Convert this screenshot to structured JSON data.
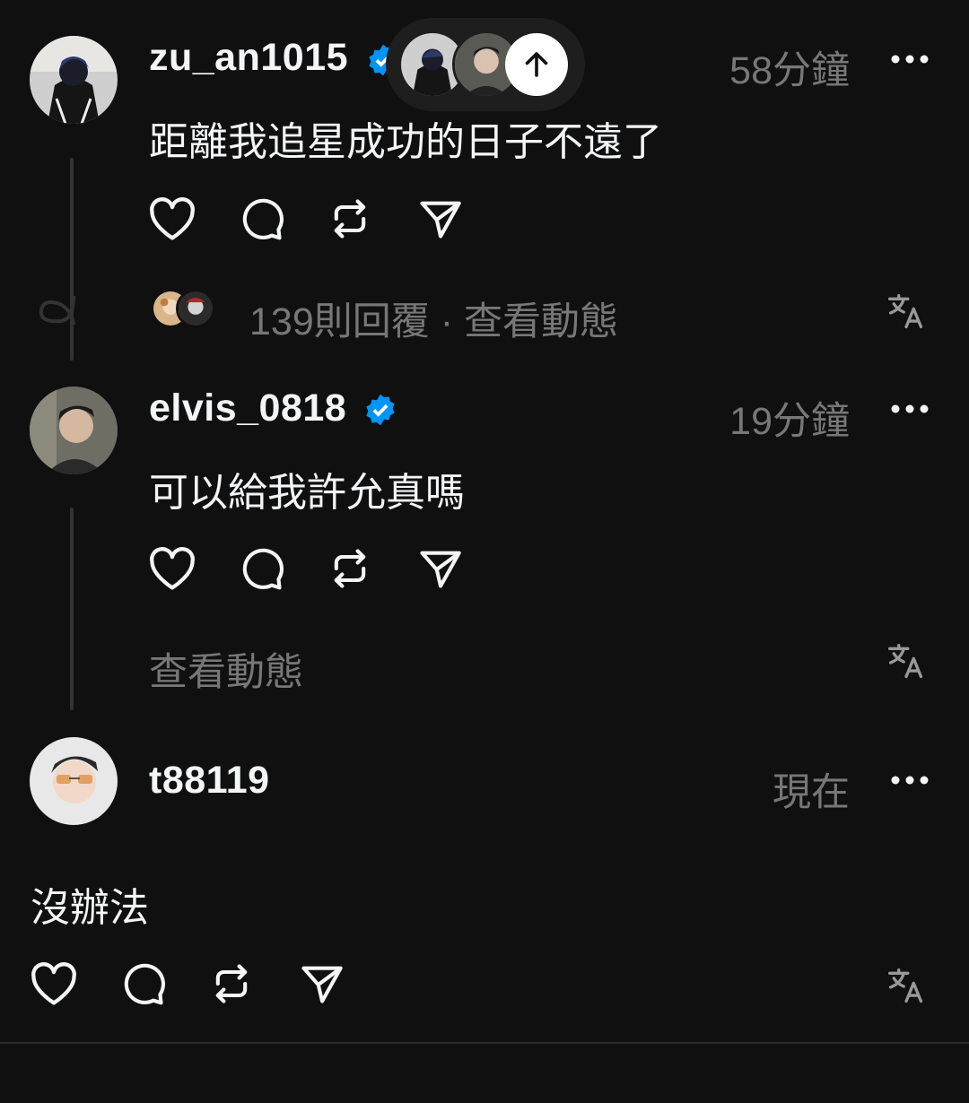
{
  "posts": [
    {
      "username": "zu_an1015",
      "verified": true,
      "time": "58分鐘",
      "text": "距離我追星成功的日子不遠了",
      "replies_text": "139則回覆 · 查看動態"
    },
    {
      "username": "elvis_0818",
      "verified": true,
      "time": "19分鐘",
      "text": "可以給我許允真嗎",
      "activity_text": "查看動態"
    },
    {
      "username": "t88119",
      "verified": false,
      "time": "現在",
      "text": "沒辦法"
    }
  ],
  "icons": {
    "like": "heart-icon",
    "reply": "comment-icon",
    "repost": "repost-icon",
    "share": "share-icon",
    "more": "more-icon",
    "translate": "translate-icon",
    "scroll_up": "arrow-up-icon",
    "verified": "verified-badge-icon"
  },
  "colors": {
    "background": "#101010",
    "text": "#f3f5f7",
    "muted": "#777777",
    "verified": "#0095f6"
  }
}
